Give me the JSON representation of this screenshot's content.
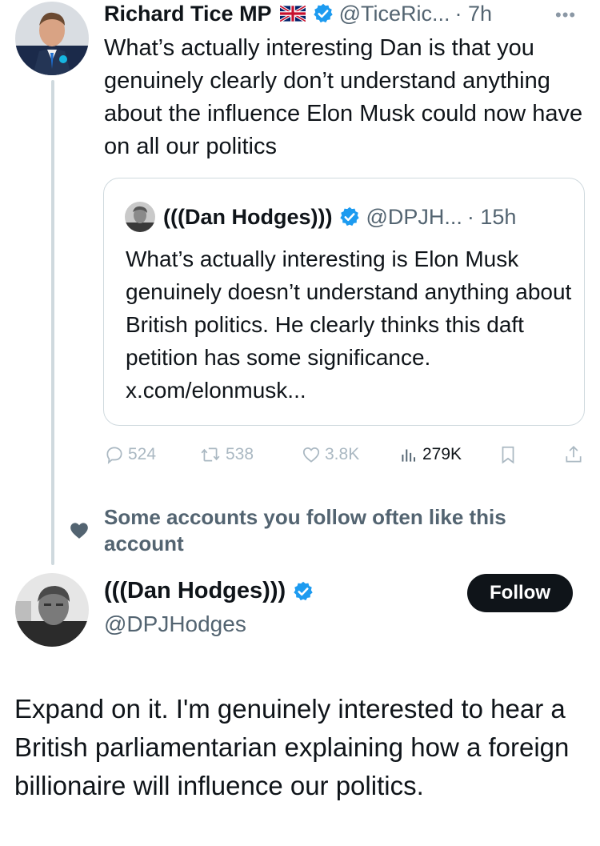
{
  "tweet": {
    "author_name": "Richard Tice MP",
    "flag_icon": "uk-flag-icon",
    "handle": "@TiceRic...",
    "time": "· 7h",
    "more_icon": "more-dots-icon",
    "text": "What’s actually interesting Dan is that you genuinely clearly don’t understand anything about the influence Elon Musk could now have on all our politics",
    "quote": {
      "author_name": "(((Dan Hodges)))",
      "handle": "@DPJH...",
      "time": "· 15h",
      "text": "What’s actually interesting is Elon Musk genuinely doesn’t understand anything about British politics. He clearly thinks this daft petition has some significance. x.com/elonmusk..."
    },
    "actions": {
      "replies": "524",
      "reposts": "538",
      "likes": "3.8K",
      "views": "279K"
    }
  },
  "social_context": "Some accounts you follow often like this account",
  "profile": {
    "name": "(((Dan Hodges)))",
    "handle": "@DPJHodges",
    "follow_label": "Follow"
  },
  "reply_text": "Expand on it. I'm genuinely interested to hear a British parliamentarian explaining how a foreign billionaire will influence our politics.",
  "colors": {
    "verified": "#1d9bf0",
    "text": "#0f1419",
    "secondary": "#536471",
    "border": "#cfd9de"
  }
}
